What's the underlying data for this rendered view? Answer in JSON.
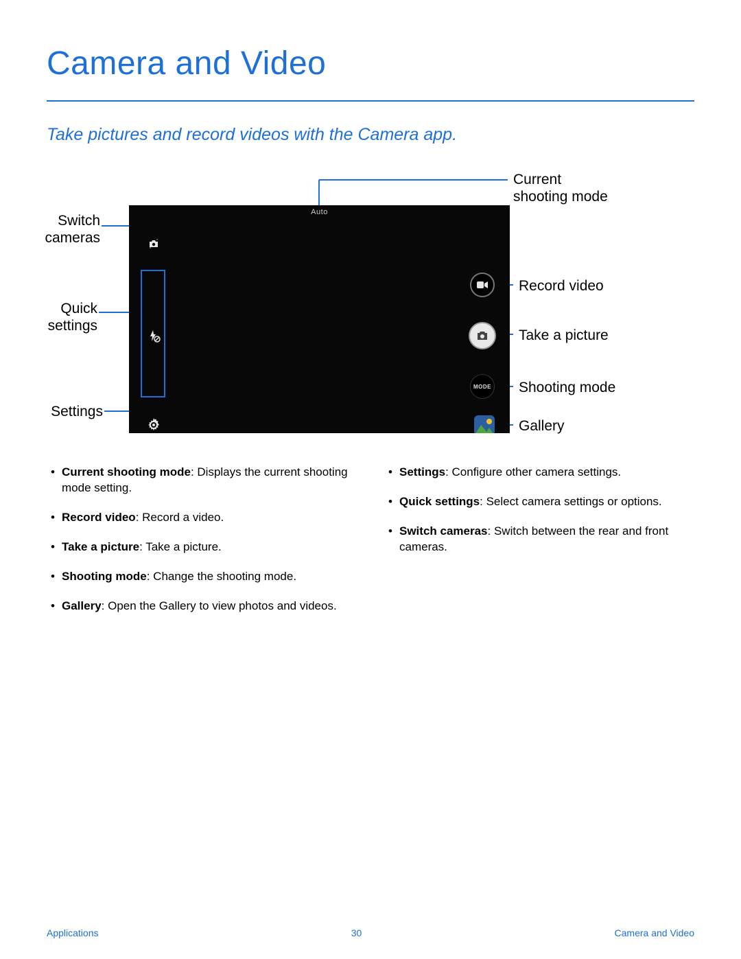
{
  "title": "Camera and Video",
  "subtitle": "Take pictures and record videos with the Camera app.",
  "camera": {
    "mode": "Auto"
  },
  "callouts": {
    "switch_cameras": "Switch\ncameras",
    "quick_settings": "Quick\nsettings",
    "settings": "Settings",
    "current_mode": "Current\nshooting mode",
    "record_video": "Record video",
    "take_picture": "Take a picture",
    "shooting_mode": "Shooting mode",
    "gallery": "Gallery"
  },
  "bullets": {
    "left": [
      {
        "term": "Current shooting mode",
        "def": ": Displays the current shooting mode setting."
      },
      {
        "term": "Record video",
        "def": ": Record a video."
      },
      {
        "term": "Take a picture",
        "def": ": Take a picture."
      },
      {
        "term": "Shooting mode",
        "def": ": Change the shooting mode."
      },
      {
        "term": "Gallery",
        "def": ": Open the Gallery to view photos and videos."
      }
    ],
    "right": [
      {
        "term": "Settings",
        "def": ": Configure other camera settings."
      },
      {
        "term": "Quick settings",
        "def": ": Select camera settings or options."
      },
      {
        "term": "Switch cameras",
        "def": ": Switch between the rear and front cameras."
      }
    ]
  },
  "footer": {
    "left": "Applications",
    "center": "30",
    "right": "Camera and Video"
  }
}
